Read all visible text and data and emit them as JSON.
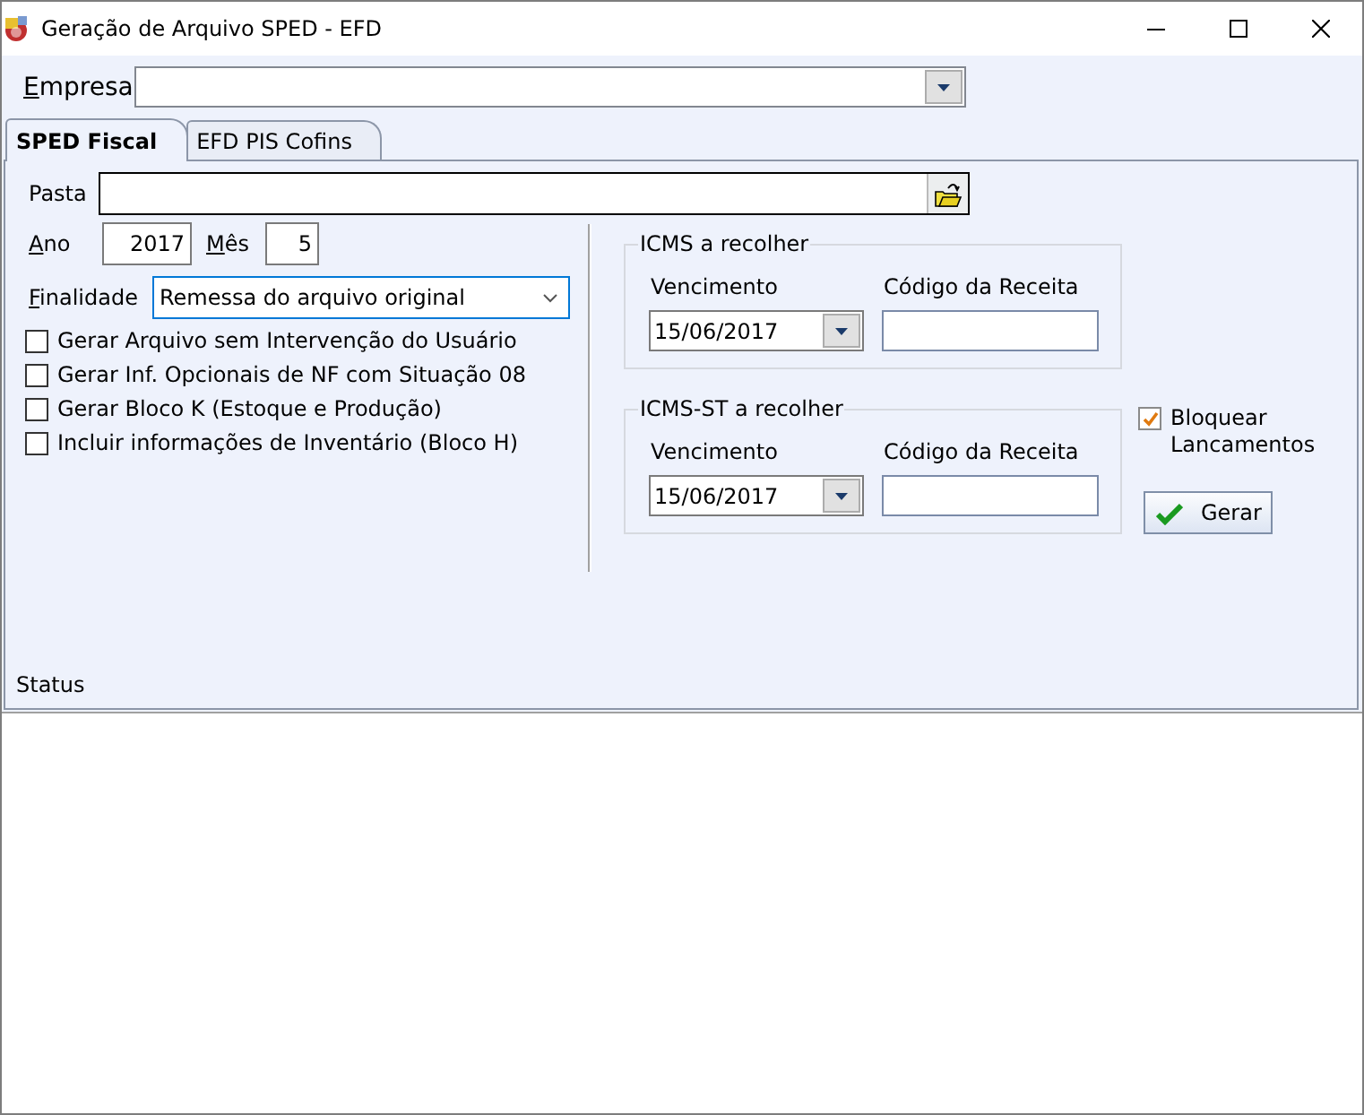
{
  "window": {
    "title": "Geração de Arquivo SPED - EFD"
  },
  "empresa": {
    "label": "Empresa"
  },
  "tabs": [
    {
      "label": "SPED Fiscal",
      "selected": true
    },
    {
      "label": "EFD PIS Cofins",
      "selected": false
    }
  ],
  "pasta": {
    "label": "Pasta"
  },
  "ano": {
    "label": "Ano",
    "value": "2017"
  },
  "mes": {
    "label": "Mês",
    "value": "5"
  },
  "finalidade": {
    "label": "Finalidade",
    "value": "Remessa do arquivo original"
  },
  "options": [
    {
      "label": "Gerar Arquivo sem Intervenção do Usuário",
      "checked": false
    },
    {
      "label": "Gerar Inf. Opcionais de NF com Situação 08",
      "checked": false
    },
    {
      "label": "Gerar Bloco K (Estoque e Produção)",
      "checked": false
    },
    {
      "label": "Incluir informações de Inventário (Bloco H)",
      "checked": false
    }
  ],
  "groups": [
    {
      "title": "ICMS a recolher",
      "vencimento_label": "Vencimento",
      "vencimento": "15/06/2017",
      "codigo_label": "Código da Receita"
    },
    {
      "title": "ICMS-ST a recolher",
      "vencimento_label": "Vencimento",
      "vencimento": "15/06/2017",
      "codigo_label": "Código da Receita"
    }
  ],
  "bloquear": {
    "label": "Bloquear Lancamentos",
    "checked": true
  },
  "gerar_button": {
    "label": "Gerar"
  },
  "status": {
    "label": "Status"
  }
}
